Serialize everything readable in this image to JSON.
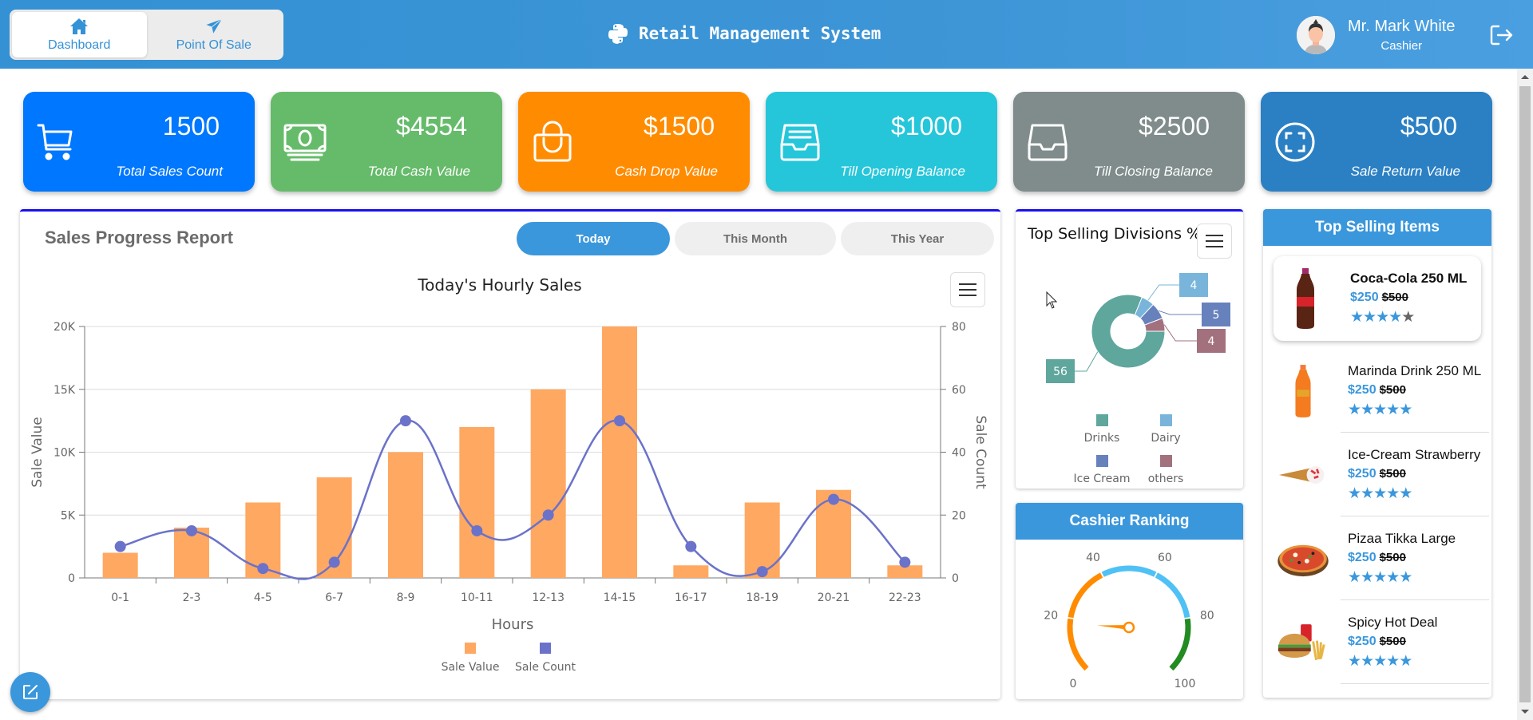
{
  "header": {
    "title": "Retail Management System",
    "nav": [
      {
        "label": "Dashboard",
        "icon": "home-icon",
        "active": true
      },
      {
        "label": "Point Of Sale",
        "icon": "send-icon",
        "active": false
      }
    ],
    "user": {
      "name": "Mr. Mark White",
      "role": "Cashier"
    }
  },
  "stat_cards": [
    {
      "value": "1500",
      "label": "Total Sales Count",
      "icon": "cart-icon",
      "color": "#0077ff"
    },
    {
      "value": "$4554",
      "label": "Total Cash Value",
      "icon": "cash-icon",
      "color": "#66bb6a"
    },
    {
      "value": "$1500",
      "label": "Cash Drop Value",
      "icon": "shopping-bag-icon",
      "color": "#ff8c00"
    },
    {
      "value": "$1000",
      "label": "Till Opening Balance",
      "icon": "archive-tray-icon",
      "color": "#26c6da"
    },
    {
      "value": "$2500",
      "label": "Till Closing Balance",
      "icon": "inbox-tray-icon",
      "color": "#7f8c8b"
    },
    {
      "value": "$500",
      "label": "Sale Return Value",
      "icon": "scan-icon",
      "color": "#2b80c4"
    }
  ],
  "sales_report": {
    "title": "Sales Progress Report",
    "tabs": [
      {
        "label": "Today",
        "active": true
      },
      {
        "label": "This Month",
        "active": false
      },
      {
        "label": "This Year",
        "active": false
      }
    ]
  },
  "chart_data": [
    {
      "type": "bar",
      "title": "Today's Hourly Sales",
      "xlabel": "Hours",
      "ylabel": "Sale Value",
      "y2label": "Sale Count",
      "categories": [
        "0-1",
        "2-3",
        "4-5",
        "6-7",
        "8-9",
        "10-11",
        "12-13",
        "14-15",
        "16-17",
        "18-19",
        "20-21",
        "22-23"
      ],
      "ylim": [
        0,
        20000
      ],
      "y_ticks": [
        "0",
        "5K",
        "10K",
        "15K",
        "20K"
      ],
      "y2lim": [
        0,
        80
      ],
      "y2_ticks": [
        "0",
        "20",
        "40",
        "60",
        "80"
      ],
      "grid": true,
      "legend_position": "bottom",
      "series": [
        {
          "name": "Sale Value",
          "type": "bar",
          "axis": "left",
          "color": "#ffa862",
          "values": [
            2000,
            4000,
            6000,
            8000,
            10000,
            12000,
            15000,
            20000,
            1000,
            6000,
            7000,
            1000
          ]
        },
        {
          "name": "Sale Count",
          "type": "spline",
          "axis": "right",
          "color": "#6b72c9",
          "values": [
            10,
            15,
            3,
            5,
            50,
            15,
            20,
            50,
            10,
            2,
            25,
            5
          ]
        }
      ]
    },
    {
      "type": "pie",
      "title": "Top Selling Divisions %",
      "donut": true,
      "legend_position": "bottom",
      "labels": [
        "Drinks",
        "Dairy",
        "Ice Cream",
        "others"
      ],
      "values": [
        56,
        4,
        5,
        4
      ],
      "colors": [
        "#5fa69d",
        "#79b5da",
        "#6781bd",
        "#a3707e"
      ]
    },
    {
      "type": "gauge",
      "title": "Cashier Ranking",
      "range": [
        0,
        100
      ],
      "ticks": [
        "0",
        "20",
        "40",
        "60",
        "80",
        "100"
      ],
      "value": 18,
      "bands": [
        {
          "from": 0,
          "to": 40,
          "color": "#ff8c00"
        },
        {
          "from": 40,
          "to": 80,
          "color": "#4fc1f5"
        },
        {
          "from": 80,
          "to": 100,
          "color": "#228b22"
        }
      ]
    }
  ],
  "top_items": {
    "title": "Top Selling Items",
    "items": [
      {
        "name": "Coca-Cola 250 ML",
        "price": "$250",
        "old_price": "$500",
        "rating": 4,
        "image": "cola-bottle"
      },
      {
        "name": "Marinda Drink 250 ML",
        "price": "$250",
        "old_price": "$500",
        "rating": 5,
        "image": "orange-bottle"
      },
      {
        "name": "Ice-Cream Strawberry",
        "price": "$250",
        "old_price": "$500",
        "rating": 5,
        "image": "ice-cream-cone"
      },
      {
        "name": "Pizaa Tikka Large",
        "price": "$250",
        "old_price": "$500",
        "rating": 5,
        "image": "pizza"
      },
      {
        "name": "Spicy Hot Deal",
        "price": "$250",
        "old_price": "$500",
        "rating": 5,
        "image": "burger-combo"
      }
    ]
  },
  "cashier_ranking": {
    "title": "Cashier Ranking"
  }
}
